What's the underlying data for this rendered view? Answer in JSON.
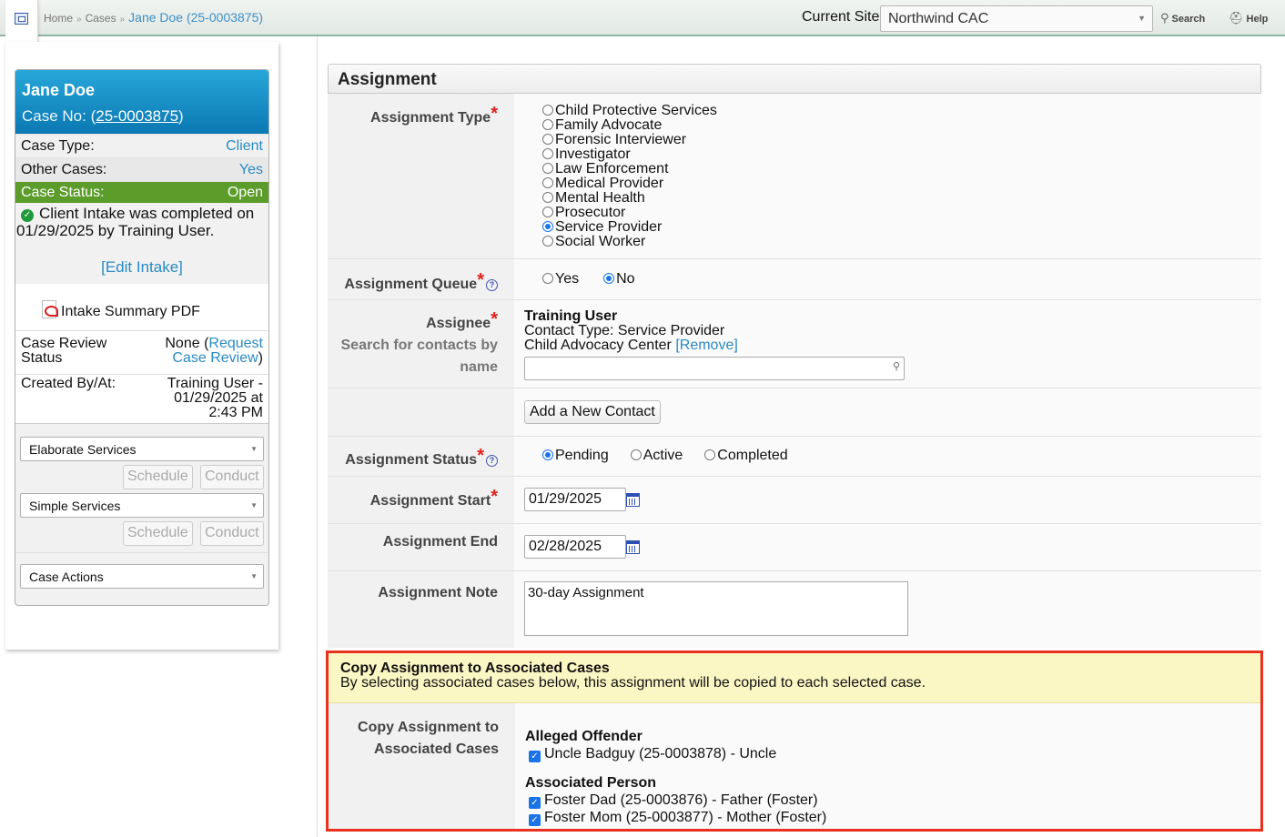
{
  "breadcrumb": {
    "items": [
      "Home",
      "Cases"
    ],
    "current": "Jane Doe (25-0003875)"
  },
  "topbar": {
    "site_label": "Current Site",
    "site_value": "Northwind CAC",
    "search_label": "Search",
    "help_label": "Help"
  },
  "case": {
    "name": "Jane Doe",
    "case_no_label": "Case No:",
    "case_no_prefix": "(",
    "case_no": "25-0003875",
    "case_no_suffix": ")",
    "case_type_label": "Case Type:",
    "case_type": "Client",
    "other_cases_label": "Other Cases:",
    "other_cases": "Yes",
    "status_label": "Case Status:",
    "status": "Open",
    "intake_msg": "Client Intake was completed on 01/29/2025 by Training User.",
    "edit_intake": "[Edit Intake]",
    "pdf_link": "Intake Summary PDF",
    "review_label": "Case Review Status",
    "review_none": "None",
    "review_open": "(",
    "review_link": "Request Case Review",
    "review_close": ")",
    "created_label": "Created By/At:",
    "created_value": "Training User - 01/29/2025 at 2:43 PM",
    "elaborate_services": "Elaborate Services",
    "simple_services": "Simple Services",
    "case_actions": "Case Actions",
    "schedule_label": "Schedule",
    "conduct_label": "Conduct"
  },
  "form": {
    "title": "Assignment",
    "assignment_type_label": "Assignment Type",
    "assignment_types": [
      "Child Protective Services",
      "Family Advocate",
      "Forensic Interviewer",
      "Investigator",
      "Law Enforcement",
      "Medical Provider",
      "Mental Health",
      "Prosecutor",
      "Service Provider",
      "Social Worker"
    ],
    "assignment_type_selected": "Service Provider",
    "queue_label": "Assignment Queue",
    "queue_options": [
      "Yes",
      "No"
    ],
    "queue_selected": "No",
    "assignee_label": "Assignee",
    "assignee_hint": "Search for contacts by name",
    "assignee_name": "Training User",
    "assignee_type": "Contact Type: Service Provider",
    "assignee_org": "Child Advocacy Center",
    "remove_link": "[Remove]",
    "assignee_search_value": "",
    "add_contact_button": "Add a New Contact",
    "status_label": "Assignment Status",
    "status_options": [
      "Pending",
      "Active",
      "Completed"
    ],
    "status_selected": "Pending",
    "start_label": "Assignment Start",
    "start_value": "01/29/2025",
    "end_label": "Assignment End",
    "end_value": "02/28/2025",
    "note_label": "Assignment Note",
    "note_value": "30-day Assignment"
  },
  "copy": {
    "heading": "Copy Assignment to Associated Cases",
    "description": "By selecting associated cases below, this assignment will be copied to each selected case.",
    "label": "Copy Assignment to Associated Cases",
    "groups": [
      {
        "title": "Alleged Offender",
        "items": [
          {
            "text": "Uncle Badguy (25-0003878) - Uncle",
            "checked": true
          }
        ]
      },
      {
        "title": "Associated Person",
        "items": [
          {
            "text": "Foster Dad (25-0003876) - Father (Foster)",
            "checked": true
          },
          {
            "text": "Foster Mom (25-0003877) - Mother (Foster)",
            "checked": true
          }
        ]
      }
    ]
  },
  "colors": {
    "accent_link": "#2a8ac4",
    "header_blue": "#0b78b2",
    "status_green": "#5c9c2b",
    "highlight_red": "#e8311f",
    "notice_yellow": "#fbf7c4"
  },
  "icons": [
    "app-icon",
    "search-icon",
    "help-icon",
    "check-icon",
    "pdf-icon",
    "calendar-icon",
    "question-icon",
    "checkbox-icon"
  ]
}
